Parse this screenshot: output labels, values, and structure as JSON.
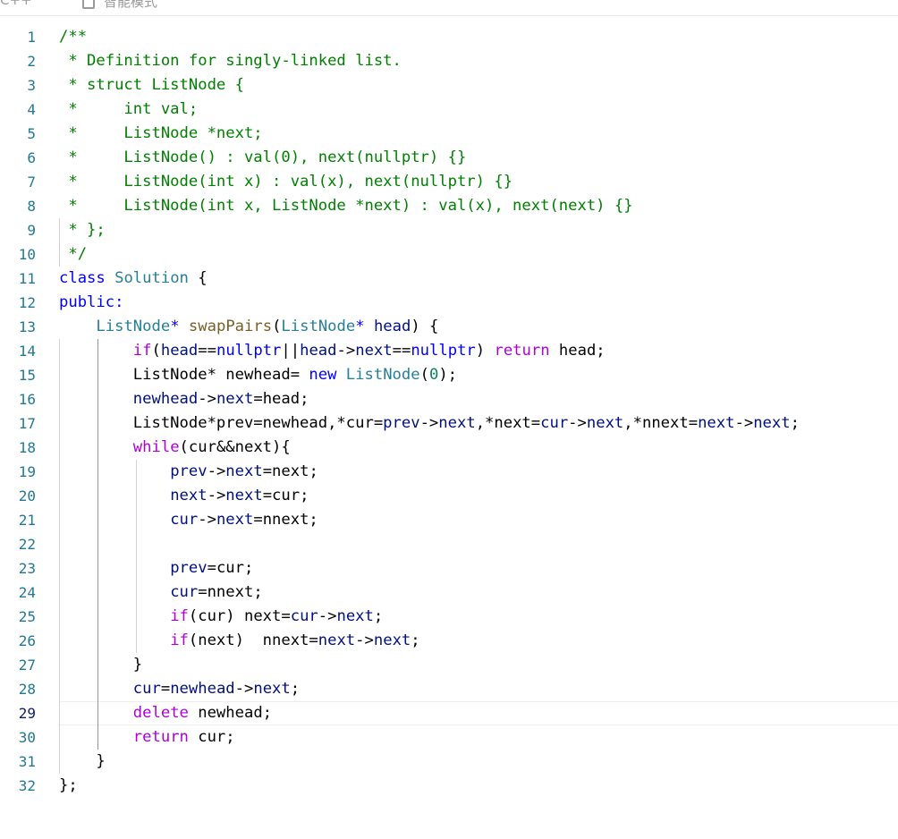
{
  "header": {
    "breadcrumb": "C++",
    "mode_label": "智能模式"
  },
  "editor": {
    "language": "cpp",
    "active_line": 29,
    "lines": [
      {
        "n": "1",
        "tokens": [
          [
            "c",
            "/**"
          ]
        ]
      },
      {
        "n": "2",
        "tokens": [
          [
            "c",
            " * Definition for singly-linked list."
          ]
        ]
      },
      {
        "n": "3",
        "tokens": [
          [
            "c",
            " * struct ListNode {"
          ]
        ]
      },
      {
        "n": "4",
        "tokens": [
          [
            "c",
            " *     int val;"
          ]
        ]
      },
      {
        "n": "5",
        "tokens": [
          [
            "c",
            " *     ListNode *next;"
          ]
        ]
      },
      {
        "n": "6",
        "tokens": [
          [
            "c",
            " *     ListNode() : val(0), next(nullptr) {}"
          ]
        ]
      },
      {
        "n": "7",
        "tokens": [
          [
            "c",
            " *     ListNode(int x) : val(x), next(nullptr) {}"
          ]
        ]
      },
      {
        "n": "8",
        "tokens": [
          [
            "c",
            " *     ListNode(int x, ListNode *next) : val(x), next(next) {}"
          ]
        ]
      },
      {
        "n": "9",
        "tokens": [
          [
            "c",
            " * };"
          ]
        ]
      },
      {
        "n": "10",
        "tokens": [
          [
            "c",
            " */"
          ]
        ]
      },
      {
        "n": "11",
        "tokens": [
          [
            "k",
            "class"
          ],
          [
            "",
            " "
          ],
          [
            "ty",
            "Solution"
          ],
          [
            "",
            " {"
          ]
        ]
      },
      {
        "n": "12",
        "tokens": [
          [
            "k",
            "public:"
          ]
        ]
      },
      {
        "n": "13",
        "tokens": [
          [
            "",
            "    "
          ],
          [
            "ty",
            "ListNode"
          ],
          [
            "k",
            "*"
          ],
          [
            "",
            " "
          ],
          [
            "f",
            "swapPairs"
          ],
          [
            "",
            "("
          ],
          [
            "ty",
            "ListNode"
          ],
          [
            "k",
            "*"
          ],
          [
            "",
            " "
          ],
          [
            "p",
            "head"
          ],
          [
            "",
            ") {"
          ]
        ]
      },
      {
        "n": "14",
        "tokens": [
          [
            "",
            "        "
          ],
          [
            "ctl",
            "if"
          ],
          [
            "",
            "("
          ],
          [
            "p",
            "head"
          ],
          [
            "",
            "=="
          ],
          [
            "k",
            "nullptr"
          ],
          [
            "",
            "||"
          ],
          [
            "p",
            "head"
          ],
          [
            "",
            "->"
          ],
          [
            "p",
            "next"
          ],
          [
            "",
            "=="
          ],
          [
            "k",
            "nullptr"
          ],
          [
            "",
            ") "
          ],
          [
            "ctl",
            "return"
          ],
          [
            "",
            " head;"
          ]
        ]
      },
      {
        "n": "15",
        "tokens": [
          [
            "",
            "        ListNode* newhead= "
          ],
          [
            "k",
            "new"
          ],
          [
            "",
            " "
          ],
          [
            "ty",
            "ListNode"
          ],
          [
            "",
            "("
          ],
          [
            "n",
            "0"
          ],
          [
            "",
            ");"
          ]
        ]
      },
      {
        "n": "16",
        "tokens": [
          [
            "",
            "        "
          ],
          [
            "p",
            "newhead"
          ],
          [
            "",
            "->"
          ],
          [
            "p",
            "next"
          ],
          [
            "",
            "=head;"
          ]
        ]
      },
      {
        "n": "17",
        "tokens": [
          [
            "",
            "        ListNode*prev=newhead,*cur="
          ],
          [
            "p",
            "prev"
          ],
          [
            "",
            "->"
          ],
          [
            "p",
            "next"
          ],
          [
            "",
            ",*next="
          ],
          [
            "p",
            "cur"
          ],
          [
            "",
            "->"
          ],
          [
            "p",
            "next"
          ],
          [
            "",
            ",*nnext="
          ],
          [
            "p",
            "next"
          ],
          [
            "",
            "->"
          ],
          [
            "p",
            "next"
          ],
          [
            "",
            ";"
          ]
        ]
      },
      {
        "n": "18",
        "tokens": [
          [
            "",
            "        "
          ],
          [
            "ctl",
            "while"
          ],
          [
            "",
            "(cur&&next){"
          ]
        ]
      },
      {
        "n": "19",
        "tokens": [
          [
            "",
            "            "
          ],
          [
            "p",
            "prev"
          ],
          [
            "",
            "->"
          ],
          [
            "p",
            "next"
          ],
          [
            "",
            "=next;"
          ]
        ]
      },
      {
        "n": "20",
        "tokens": [
          [
            "",
            "            "
          ],
          [
            "p",
            "next"
          ],
          [
            "",
            "->"
          ],
          [
            "p",
            "next"
          ],
          [
            "",
            "=cur;"
          ]
        ]
      },
      {
        "n": "21",
        "tokens": [
          [
            "",
            "            "
          ],
          [
            "p",
            "cur"
          ],
          [
            "",
            "->"
          ],
          [
            "p",
            "next"
          ],
          [
            "",
            "=nnext;"
          ]
        ]
      },
      {
        "n": "22",
        "tokens": []
      },
      {
        "n": "23",
        "tokens": [
          [
            "",
            "            "
          ],
          [
            "p",
            "prev"
          ],
          [
            "",
            "=cur;"
          ]
        ]
      },
      {
        "n": "24",
        "tokens": [
          [
            "",
            "            "
          ],
          [
            "p",
            "cur"
          ],
          [
            "",
            "=nnext;"
          ]
        ]
      },
      {
        "n": "25",
        "tokens": [
          [
            "",
            "            "
          ],
          [
            "ctl",
            "if"
          ],
          [
            "",
            "(cur) next="
          ],
          [
            "p",
            "cur"
          ],
          [
            "",
            "->"
          ],
          [
            "p",
            "next"
          ],
          [
            "",
            ";"
          ]
        ]
      },
      {
        "n": "26",
        "tokens": [
          [
            "",
            "            "
          ],
          [
            "ctl",
            "if"
          ],
          [
            "",
            "(next)  nnext="
          ],
          [
            "p",
            "next"
          ],
          [
            "",
            "->"
          ],
          [
            "p",
            "next"
          ],
          [
            "",
            ";"
          ]
        ]
      },
      {
        "n": "27",
        "tokens": [
          [
            "",
            "        }"
          ]
        ]
      },
      {
        "n": "28",
        "tokens": [
          [
            "",
            "        "
          ],
          [
            "p",
            "cur"
          ],
          [
            "",
            "="
          ],
          [
            "p",
            "newhead"
          ],
          [
            "",
            "->"
          ],
          [
            "p",
            "next"
          ],
          [
            "",
            ";"
          ]
        ]
      },
      {
        "n": "29",
        "tokens": [
          [
            "",
            "        "
          ],
          [
            "ctl",
            "delete"
          ],
          [
            "",
            " newhead;"
          ]
        ]
      },
      {
        "n": "30",
        "tokens": [
          [
            "",
            "        "
          ],
          [
            "ctl",
            "return"
          ],
          [
            "",
            " cur;"
          ]
        ]
      },
      {
        "n": "31",
        "tokens": [
          [
            "",
            "    }"
          ]
        ]
      },
      {
        "n": "32",
        "tokens": [
          [
            "",
            "};"
          ]
        ]
      }
    ]
  }
}
